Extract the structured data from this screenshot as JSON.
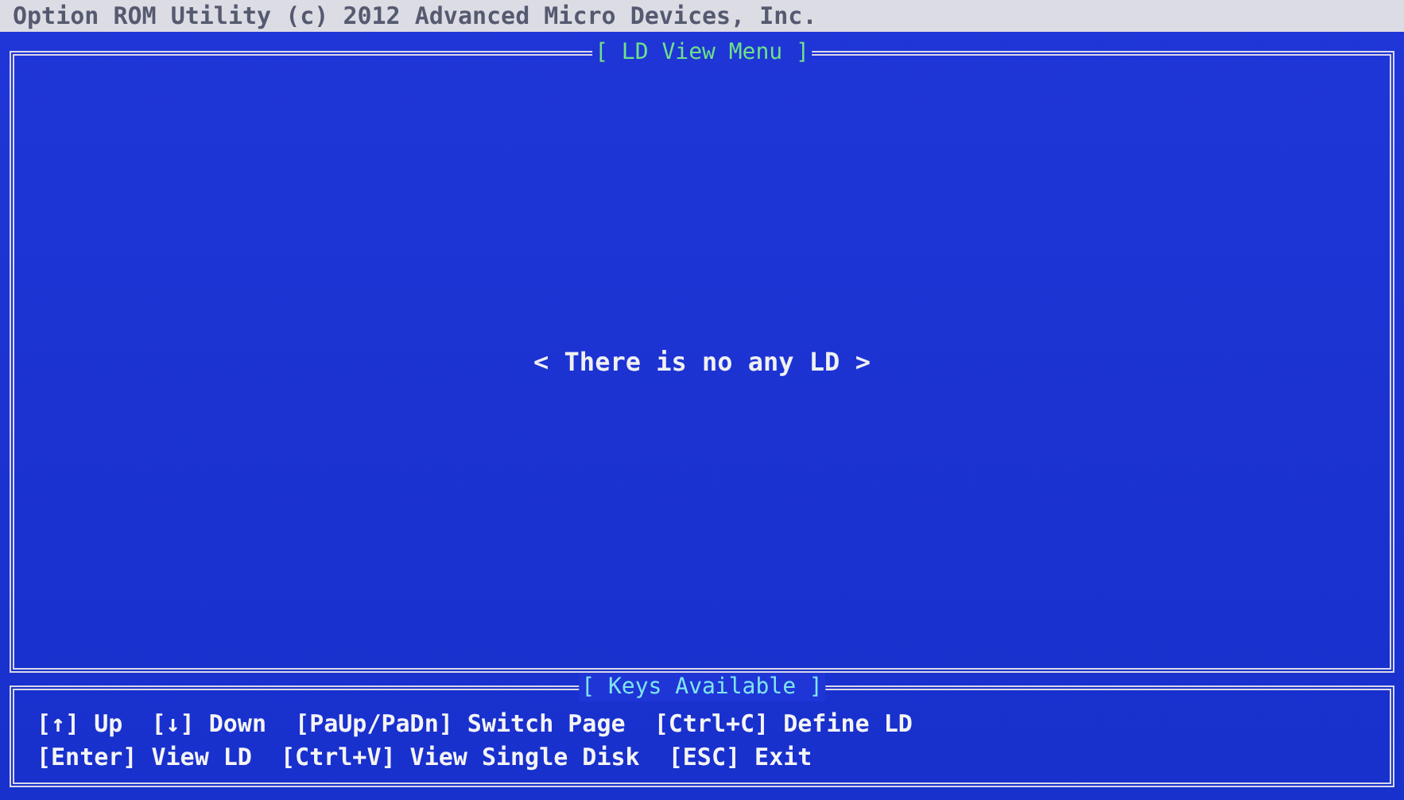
{
  "header": {
    "title": "Option ROM Utility (c) 2012 Advanced Micro Devices, Inc."
  },
  "main_panel": {
    "title": "[ LD View Menu ]",
    "message": "< There is no any LD >"
  },
  "keys_panel": {
    "title": "[ Keys Available ]",
    "lines": [
      "[↑] Up  [↓] Down  [PaUp/PaDn] Switch Page  [Ctrl+C] Define LD",
      "[Enter] View LD  [Ctrl+V] View Single Disk  [ESC] Exit"
    ]
  }
}
